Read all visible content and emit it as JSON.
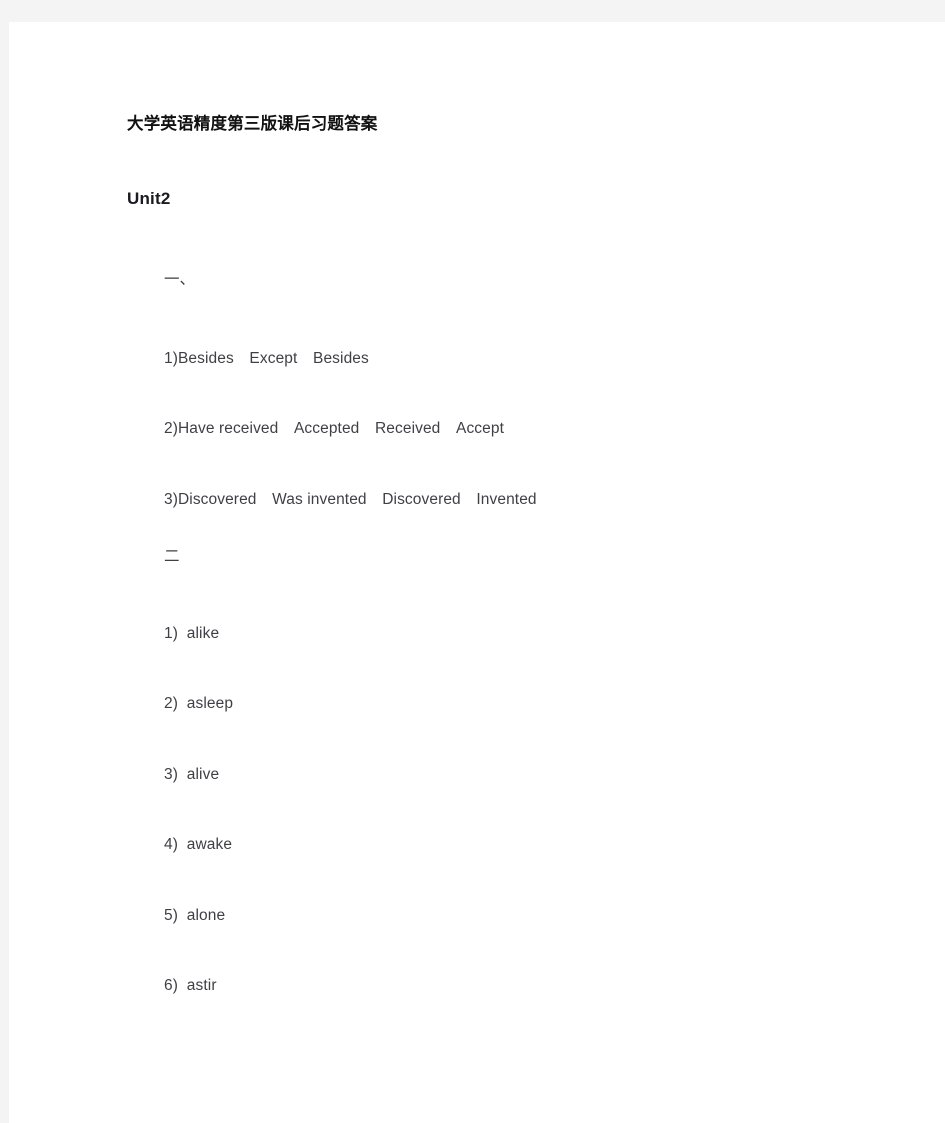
{
  "document": {
    "title": "大学英语精度第三版课后习题答案",
    "unit_heading": "Unit2",
    "background_color": "#f4f4f4",
    "page_color": "#ffffff",
    "text_color": "#3f3f46",
    "heading_color": "#111111"
  },
  "sections": [
    {
      "marker": "一、",
      "items": [
        "1)Besides　Except　Besides",
        "2)Have received　Accepted　Received　Accept",
        "3)Discovered　Was invented　Discovered　Invented"
      ]
    },
    {
      "marker": "二",
      "items": [
        "1)  alike",
        "2)  asleep",
        "3)  alive",
        "4)  awake",
        "5)  alone",
        "6)  astir"
      ]
    }
  ]
}
